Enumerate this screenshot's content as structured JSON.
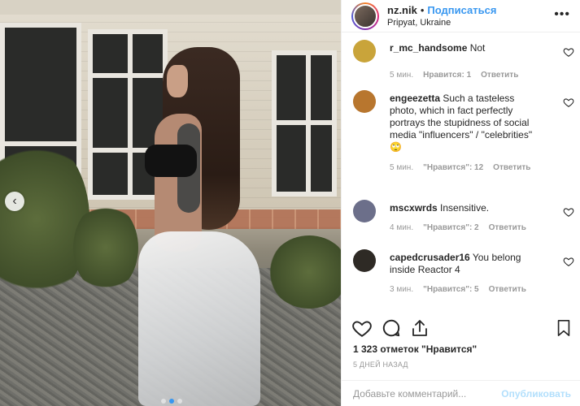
{
  "header": {
    "username": "nz.nik",
    "separator": "•",
    "follow_label": "Подписаться",
    "location": "Pripyat, Ukraine",
    "more_icon": "more-horizontal-icon",
    "more_glyph": "•••"
  },
  "photo": {
    "prev_arrow_glyph": "‹",
    "pagination_dots": 3,
    "active_dot": 1
  },
  "comments": [
    {
      "username": "r_mc_handsome",
      "text": "Not",
      "time": "5 мин.",
      "likes": "Нравится: 1",
      "reply": "Ответить",
      "avatar_color": "#c9a43a"
    },
    {
      "username": "engeezetta",
      "text": "Such a tasteless photo, which in fact perfectly portrays the stupidness of social media \"influencers\" / \"celebrities\"",
      "emoji": "🙄",
      "time": "5 мин.",
      "likes": "\"Нравится\": 12",
      "reply": "Ответить",
      "avatar_color": "#b8762e"
    },
    {
      "username": "mscxwrds",
      "text": "Insensitive.",
      "time": "4 мин.",
      "likes": "\"Нравится\": 2",
      "reply": "Ответить",
      "avatar_color": "#6c6f8a"
    },
    {
      "username": "capedcrusader16",
      "text": "You belong inside Reactor 4",
      "time": "3 мин.",
      "likes": "\"Нравится\": 5",
      "reply": "Ответить",
      "avatar_color": "#2e2a25"
    }
  ],
  "actions": {
    "like_icon": "heart-icon",
    "comment_icon": "comment-icon",
    "share_icon": "share-icon",
    "save_icon": "bookmark-icon"
  },
  "likes_text": "1 323 отметок \"Нравится\"",
  "time_ago": "5 ДНЕЙ НАЗАД",
  "add_comment": {
    "placeholder": "Добавьте комментарий...",
    "publish_label": "Опубликовать"
  },
  "colors": {
    "accent": "#3897f0",
    "publish_disabled": "#b2dffc",
    "meta_text": "#999999"
  }
}
